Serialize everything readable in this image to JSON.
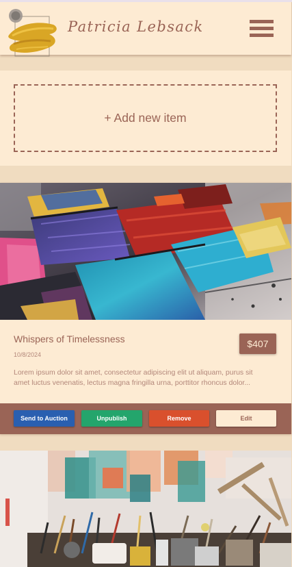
{
  "header": {
    "title": "Patricia Lebsack",
    "logo_icon": "gold-paint-swatch-logo",
    "menu_icon": "hamburger-menu-icon"
  },
  "add_item": {
    "label": "+ Add new item"
  },
  "cards": [
    {
      "image": "paint-brushes-photo",
      "title": "Whispers of Timelessness",
      "date": "10/8/2024",
      "price": "$407",
      "description": "Lorem ipsum dolor sit amet, consectetur adipiscing elit ut aliquam, purus sit amet luctus venenatis, lectus magna fringilla urna, porttitor rhoncus dolor...",
      "actions": {
        "send_to_auction": "Send to Auction",
        "unpublish": "Unpublish",
        "remove": "Remove",
        "edit": "Edit"
      }
    },
    {
      "image": "art-studio-supplies-photo"
    }
  ],
  "colors": {
    "primary": "#9a6456",
    "background": "#f0dcc0",
    "surface": "#fdebd3",
    "auction": "#2a5fb0",
    "unpublish": "#24a56c",
    "remove": "#d9502d",
    "logo_gold": "#d9a625"
  }
}
